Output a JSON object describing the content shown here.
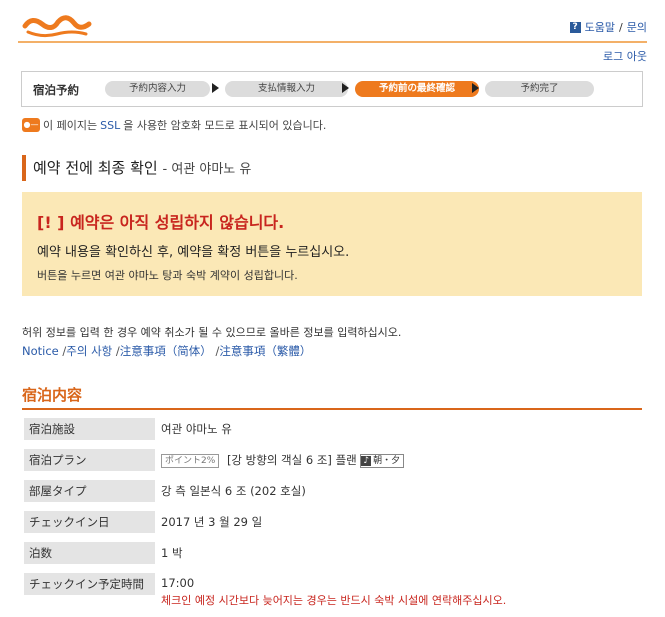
{
  "header": {
    "help_label": "도움말",
    "separator": "/",
    "contact_label": "문의",
    "logout_label": "로그 아웃",
    "accent": "#ee7a1e"
  },
  "steps": {
    "title": "宿泊予約",
    "items": [
      {
        "label": "予約内容入力",
        "active": false
      },
      {
        "label": "支払情報入力",
        "active": false
      },
      {
        "label": "予約前の最終確認",
        "active": true
      },
      {
        "label": "予約完了",
        "active": false
      }
    ]
  },
  "ssl_notice": {
    "prefix": "이 페이지는",
    "ssl": "SSL",
    "suffix": "을 사용한 암호화 모드로 표시되어 있습니다."
  },
  "page_title": {
    "main": "예약 전에 최종 확인",
    "sub": "- 여관 야마노 유"
  },
  "warning": {
    "line1": "[! ] 예약은 아직 성립하지 않습니다.",
    "line2": "예약 내용을 확인하신 후, 예약을 확정 버튼을 누르십시오.",
    "line3": "버튼을 누르면 여관 야마노 탕과 숙박 계약이 성립합니다."
  },
  "info_text": "허위 정보를 입력 한 경우 예약 취소가 될 수 있으므로 올바른 정보를 입력하십시오.",
  "links": {
    "notice": "Notice",
    "caution": "주의 사항",
    "simplified": "注意事項（简体）",
    "traditional": "注意事項（繁體）",
    "sep": "/"
  },
  "section_title": "宿泊内容",
  "details": {
    "facility_label": "宿泊施設",
    "facility_value": "여관 야마노 유",
    "plan_label": "宿泊プラン",
    "plan_badge": "ポイント2%",
    "plan_value": "[강 방향의 객실 6 조] 플랜",
    "plan_meal": "朝・夕",
    "room_label": "部屋タイプ",
    "room_value": "강 측 일본식 6 조 (202 호실)",
    "checkin_label": "チェックイン日",
    "checkin_value": "2017 년 3 월 29 일",
    "nights_label": "泊数",
    "nights_value": "1 박",
    "time_label": "チェックイン予定時間",
    "time_value": "17:00",
    "time_note": "체크인 예정 시간보다 늦어지는 경우는 반드시 숙박 시설에 연락해주십시오."
  }
}
